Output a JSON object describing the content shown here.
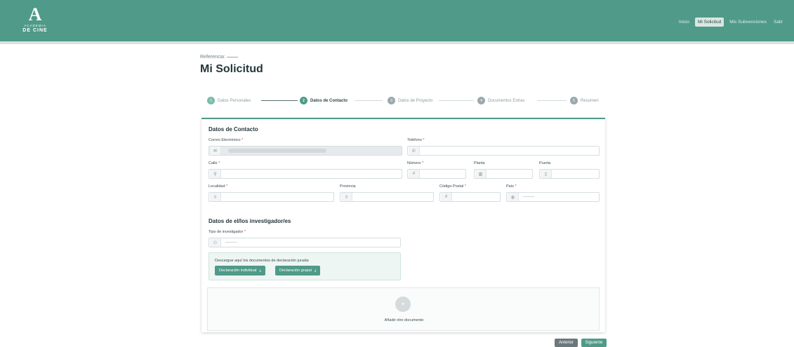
{
  "header": {
    "logo_letter": "A",
    "logo_sub": "ACADEMIA",
    "logo_main": "DE CINE",
    "nav": [
      "Inicio",
      "Mi Solicitud",
      "Mis Subvenciones",
      "Salir"
    ],
    "nav_active": "Mi Solicitud",
    "colors": {
      "brand": "#4f9a88"
    }
  },
  "page": {
    "reference_label": "Referencia:",
    "title": "Mi Solicitud"
  },
  "stepper": {
    "steps": [
      {
        "num": "1",
        "label": "Datos Personales",
        "state": "done"
      },
      {
        "num": "2",
        "label": "Datos de Contacto",
        "state": "current"
      },
      {
        "num": "3",
        "label": "Datos de Proyecto",
        "state": "pending"
      },
      {
        "num": "4",
        "label": "Documentos Extras",
        "state": "pending"
      },
      {
        "num": "5",
        "label": "Resumen",
        "state": "pending"
      }
    ]
  },
  "contact": {
    "section_title": "Datos de Contacto",
    "email_label": "Correo Electrónico",
    "phone_label": "Teléfono",
    "street_label": "Calle",
    "number_label": "Número",
    "floor_label": "Planta",
    "door_label": "Puerta",
    "city_label": "Localidad",
    "province_label": "Provincia",
    "postal_label": "Código Postal",
    "country_label": "País",
    "country_value": "———"
  },
  "researchers": {
    "section_title": "Datos de el/los investigador/es",
    "type_label": "Tipo de investigador",
    "type_value": "———",
    "download_text": "Descargue aquí los documentos de declaración jurada:",
    "btn_individual": "Declaración individual",
    "btn_group": "Declaración grupal",
    "add_doc_label": "Añadir otro documento"
  },
  "actions": {
    "prev": "Anterior",
    "next": "Siguiente"
  },
  "required_mark": "*"
}
